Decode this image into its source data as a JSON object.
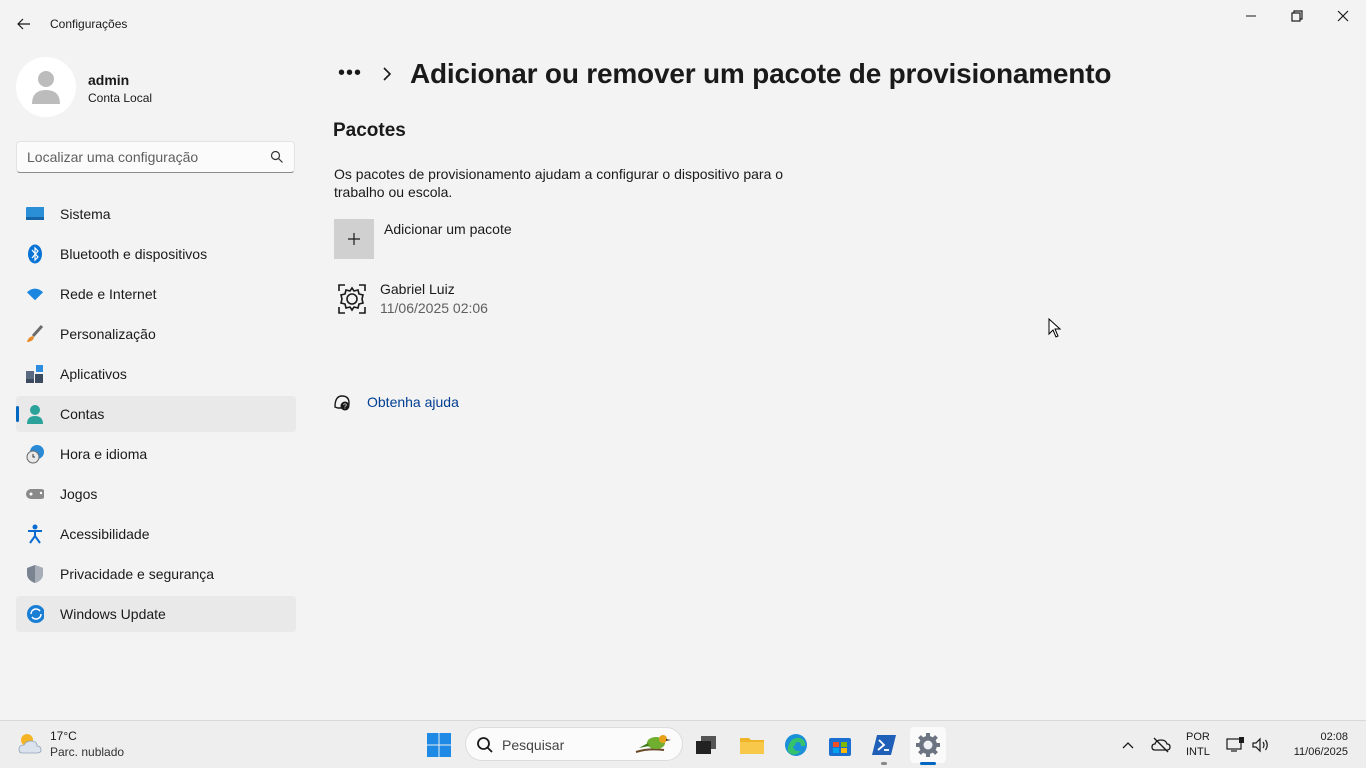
{
  "window": {
    "title": "Configurações",
    "controls": [
      "minimize-icon",
      "restore-icon",
      "close-icon"
    ]
  },
  "profile": {
    "name": "admin",
    "account_type": "Conta Local"
  },
  "search": {
    "placeholder": "Localizar uma configuração"
  },
  "sidebar": {
    "items": [
      {
        "label": "Sistema",
        "icon": "system-icon"
      },
      {
        "label": "Bluetooth e dispositivos",
        "icon": "bluetooth-icon"
      },
      {
        "label": "Rede e Internet",
        "icon": "wifi-icon"
      },
      {
        "label": "Personalização",
        "icon": "brush-icon"
      },
      {
        "label": "Aplicativos",
        "icon": "apps-icon"
      },
      {
        "label": "Contas",
        "icon": "accounts-icon",
        "selected": true
      },
      {
        "label": "Hora e idioma",
        "icon": "time-language-icon"
      },
      {
        "label": "Jogos",
        "icon": "gamepad-icon"
      },
      {
        "label": "Acessibilidade",
        "icon": "accessibility-icon"
      },
      {
        "label": "Privacidade e segurança",
        "icon": "shield-icon"
      },
      {
        "label": "Windows Update",
        "icon": "windows-update-icon",
        "hovered": true
      }
    ]
  },
  "main": {
    "breadcrumb_more": "•••",
    "title": "Adicionar ou remover um pacote de provisionamento",
    "section_title": "Pacotes",
    "description": "Os pacotes de provisionamento ajudam a configurar o dispositivo para o trabalho ou escola.",
    "add_package_label": "Adicionar um pacote",
    "package": {
      "name": "Gabriel Luiz",
      "date": "11/06/2025 02:06"
    },
    "help_link": "Obtenha ajuda"
  },
  "taskbar": {
    "weather_temp": "17°C",
    "weather_desc": "Parc. nublado",
    "search_label": "Pesquisar",
    "language_line1": "POR",
    "language_line2": "INTL",
    "time": "02:08",
    "date": "11/06/2025"
  },
  "colors": {
    "accent": "#0067c0",
    "link": "#003e92",
    "background": "#f3f3f3"
  }
}
